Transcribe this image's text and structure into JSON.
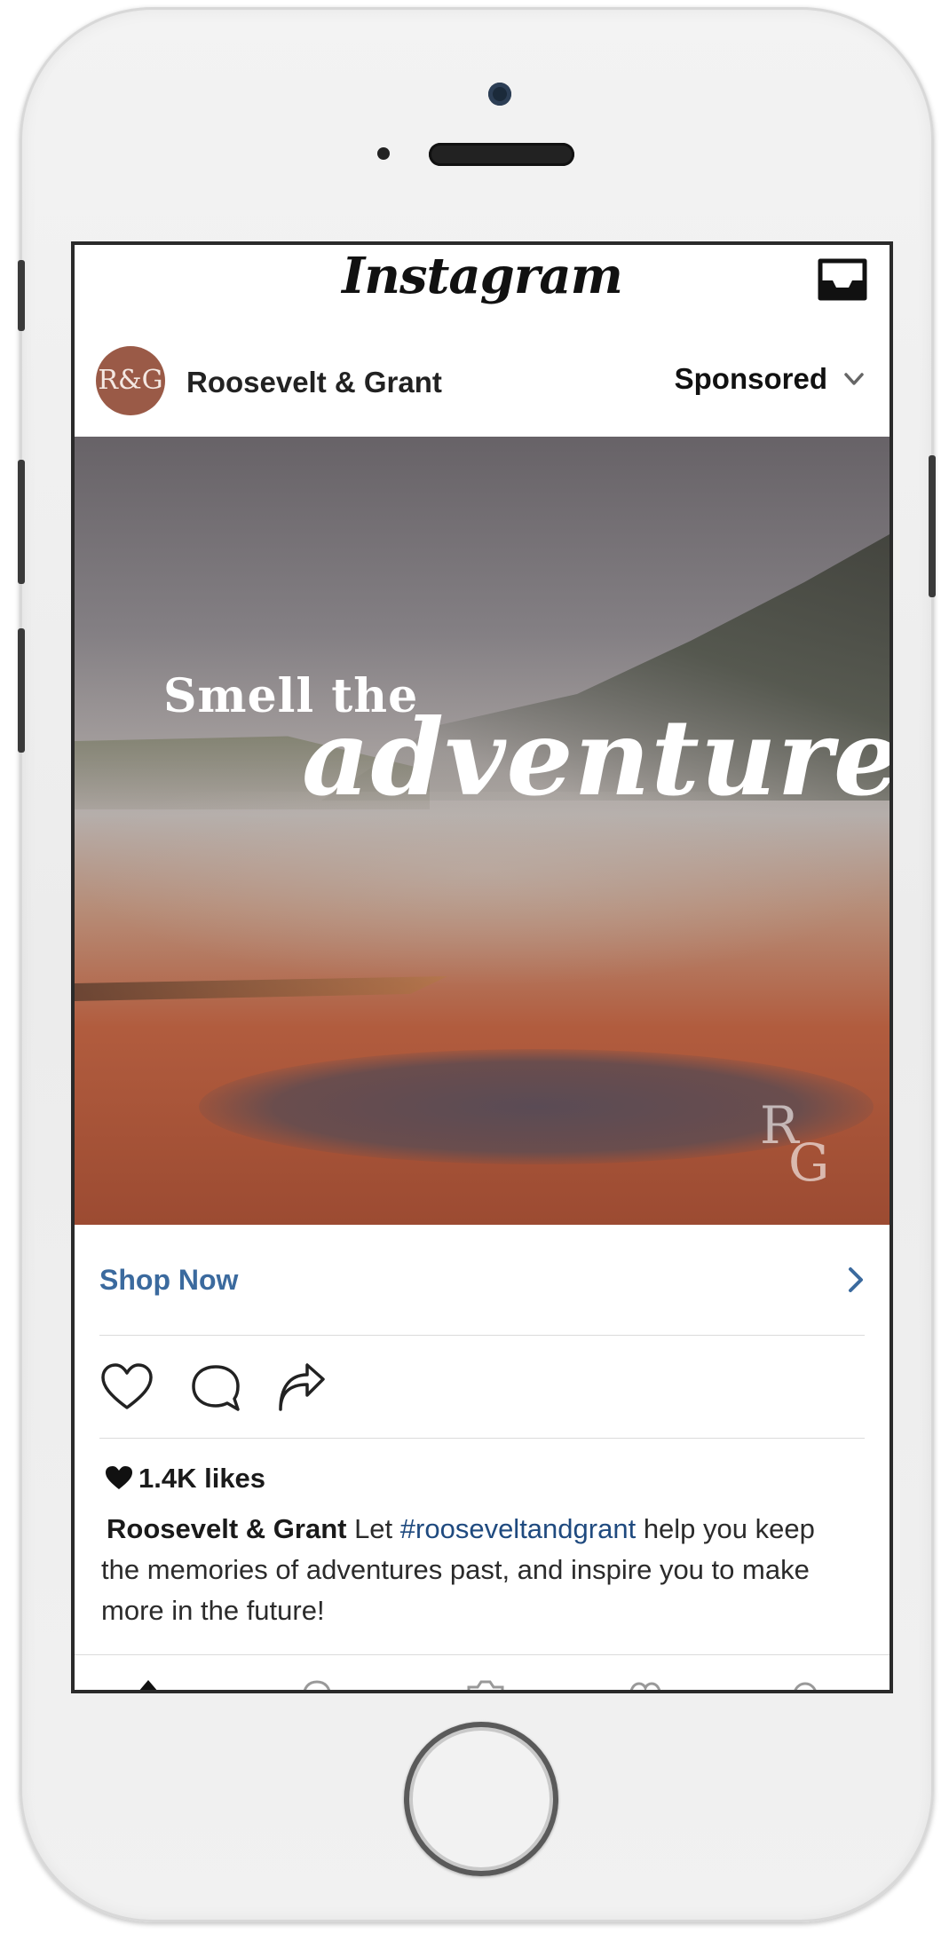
{
  "app": {
    "name": "Instagram"
  },
  "post": {
    "account_name": "Roosevelt & Grant",
    "avatar_initials": "R&G",
    "sponsored_label": "Sponsored",
    "image": {
      "headline_line1": "Smell the",
      "headline_line2": "adventure",
      "watermark_r": "R",
      "watermark_g": "G"
    },
    "cta_label": "Shop Now",
    "likes": "1.4K likes",
    "caption": {
      "user": "Roosevelt & Grant",
      "text_before": " Let ",
      "hashtag": "#rooseveltandgrant",
      "text_after": " help you keep the memories of adventures past, and inspire you to make more in the future!"
    }
  },
  "icons": {
    "inbox": "inbox-icon",
    "options": "chevron-down-icon",
    "cta": "chevron-right-icon",
    "like": "heart-icon",
    "comment": "comment-icon",
    "share": "share-icon",
    "likes_heart": "heart-filled-icon"
  },
  "colors": {
    "cta_blue": "#3b6a9e",
    "hashtag_blue": "#1f4a7f",
    "avatar_brown": "#9a5a47"
  }
}
